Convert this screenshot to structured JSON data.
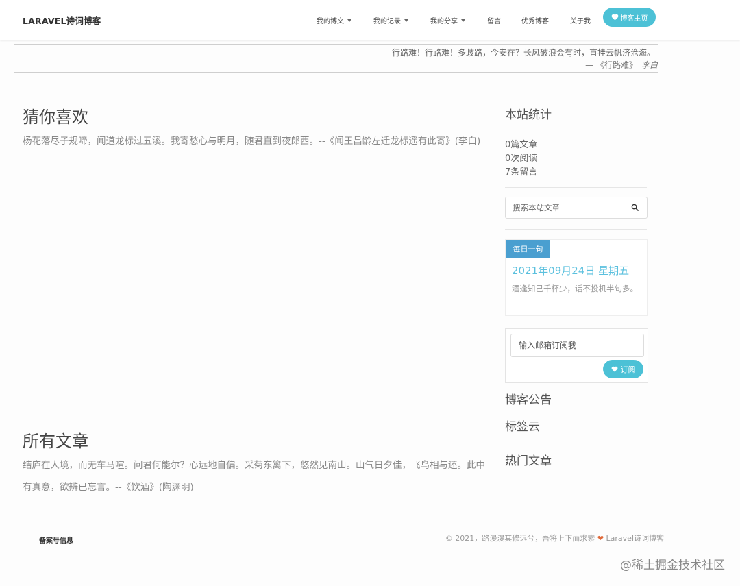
{
  "navbar": {
    "brand": "LARAVEL诗词博客",
    "items": [
      {
        "label": "我的博文",
        "dropdown": true
      },
      {
        "label": "我的记录",
        "dropdown": true
      },
      {
        "label": "我的分享",
        "dropdown": true
      },
      {
        "label": "留言",
        "dropdown": false
      },
      {
        "label": "优秀博客",
        "dropdown": false
      },
      {
        "label": "关于我",
        "dropdown": false
      }
    ],
    "home_button": "博客主页",
    "accent": "#4cc1d6"
  },
  "quote": {
    "text": "行路难！行路难！多歧路，今安在？长风破浪会有时，直挂云帆济沧海。",
    "source": "— 《行路难》",
    "author": "李白"
  },
  "main": {
    "guess": {
      "title": "猜你喜欢",
      "text": "杨花落尽子规啼，闻道龙标过五溪。我寄愁心与明月，随君直到夜郎西。--《闻王昌龄左迁龙标遥有此寄》(李白)"
    },
    "all": {
      "title": "所有文章",
      "text": "结庐在人境，而无车马喧。问君何能尔？心远地自偏。采菊东篱下，悠然见南山。山气日夕佳，飞鸟相与还。此中有真意，欲辨已忘言。--《饮酒》(陶渊明)"
    }
  },
  "sidebar": {
    "stats_title": "本站统计",
    "stats": [
      {
        "value": "0",
        "unit": "篇文章"
      },
      {
        "value": "0",
        "unit": "次阅读"
      },
      {
        "value": "7",
        "unit": "条留言"
      }
    ],
    "search_placeholder": "搜索本站文章",
    "daily": {
      "tag": "每日一句",
      "date": "2021年09月24日 星期五",
      "text": "酒逢知己千杯少，话不投机半句多。",
      "tag_color": "#4a9fd0"
    },
    "subscribe": {
      "placeholder": "输入邮箱订阅我",
      "button": "订阅"
    },
    "announce_title": "博客公告",
    "tags_title": "标签云",
    "hot_title": "热门文章"
  },
  "footer": {
    "left": "备案号信息",
    "right_text": "© 2021，路漫漫其修远兮，吾将上下而求索",
    "right_brand": "Laravel诗词博客"
  },
  "watermark": "@稀土掘金技术社区"
}
